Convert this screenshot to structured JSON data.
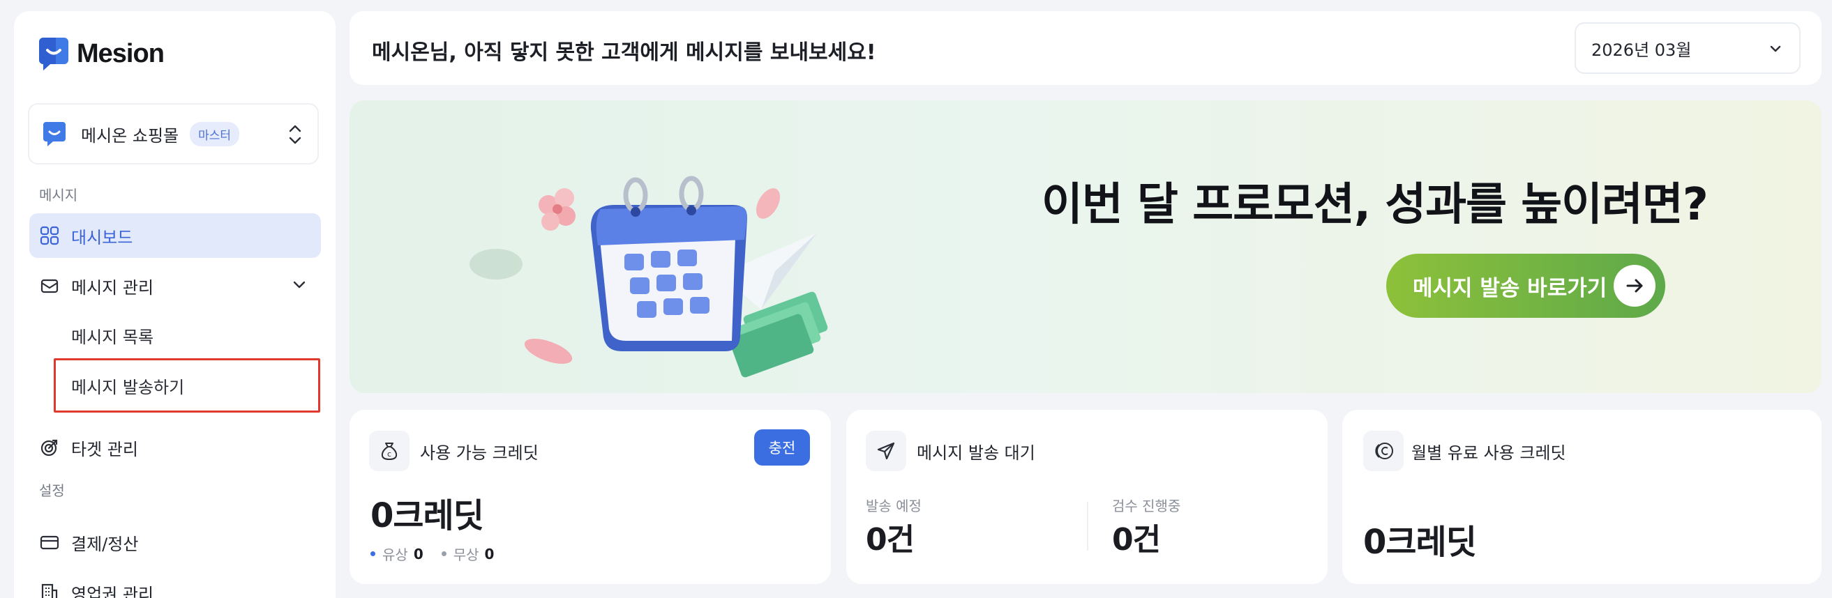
{
  "brand": {
    "name": "Mesion"
  },
  "workspace": {
    "name": "메시온 쇼핑몰",
    "badge": "마스터"
  },
  "sidebar": {
    "section_message": "메시지",
    "dashboard": "대시보드",
    "message_manage": "메시지 관리",
    "message_list": "메시지 목록",
    "message_send": "메시지 발송하기",
    "target_manage": "타겟 관리",
    "section_settings": "설정",
    "billing": "결제/정산",
    "business": "영업권 관리"
  },
  "header": {
    "greeting": "메시온님, 아직 닿지 못한 고객에게 메시지를 보내보세요!",
    "month": "2026년 03월"
  },
  "banner": {
    "title": "이번 달 프로모션, 성과를 높이려면?",
    "cta": "메시지 발송 바로가기"
  },
  "cards": {
    "credit": {
      "title": "사용 가능 크레딧",
      "charge": "충전",
      "value": "0크레딧",
      "paid_label": "유상",
      "paid_value": "0",
      "free_label": "무상",
      "free_value": "0"
    },
    "pending": {
      "title": "메시지 발송 대기",
      "scheduled_label": "발송 예정",
      "scheduled_value": "0건",
      "review_label": "검수 진행중",
      "review_value": "0건"
    },
    "monthly": {
      "title": "월별 유료 사용 크레딧",
      "value": "0크레딧"
    }
  },
  "colors": {
    "accent": "#3b6ee0",
    "active_bg": "#e2e9fb",
    "cta_start": "#8dc13a",
    "cta_end": "#5ea94a",
    "highlight": "#e03a2f"
  }
}
